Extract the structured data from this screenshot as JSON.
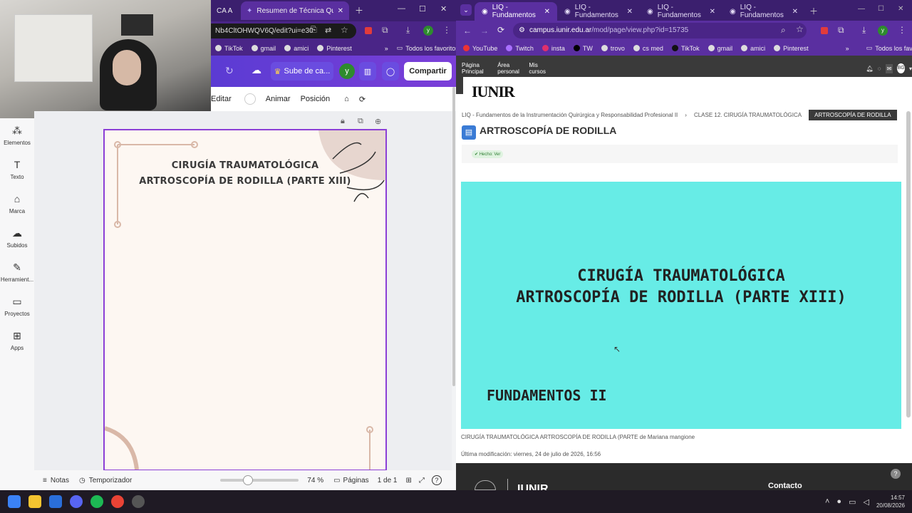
{
  "left": {
    "tabs": [
      {
        "label": "CA A"
      },
      {
        "label": "Resumen de Técnica Quirúrgic"
      }
    ],
    "url": "Nb4CltOHWQV6Q/edit?ui=e30",
    "bookmarks": [
      "TikTok",
      "gmail",
      "amici",
      "Pinterest"
    ],
    "bookmarks_folder": "Todos los favoritos",
    "upload_button": "Sube de ca...",
    "avatar_letter": "y",
    "share_button": "Compartir",
    "toolbar": {
      "edit": "Editar",
      "animate": "Animar",
      "position": "Posición"
    },
    "sidebar": [
      {
        "label": "Elementos",
        "icon": "elements-icon"
      },
      {
        "label": "Texto",
        "icon": "text-icon"
      },
      {
        "label": "Marca",
        "icon": "brand-icon"
      },
      {
        "label": "Subidos",
        "icon": "uploads-icon"
      },
      {
        "label": "Herramient...",
        "icon": "tools-icon"
      },
      {
        "label": "Proyectos",
        "icon": "projects-icon"
      },
      {
        "label": "Apps",
        "icon": "apps-icon"
      }
    ],
    "doc": {
      "line1": "CIRUGÍA TRAUMATOLÓGICA",
      "line2": "ARTROSCOPÍA DE RODILLA (PARTE XIII)"
    },
    "bottom": {
      "notes": "Notas",
      "timer": "Temporizador",
      "zoom": "74 %",
      "zoom_level": 0.35,
      "pages": "Páginas",
      "page_count": "1 de 1"
    }
  },
  "right": {
    "tabs": [
      {
        "label": "LIQ - Fundamentos"
      },
      {
        "label": "LIQ - Fundamentos"
      },
      {
        "label": "LIQ - Fundamentos"
      },
      {
        "label": "LIQ - Fundamentos"
      }
    ],
    "url_domain": "campus.iunir.edu.ar",
    "url_path": "/mod/page/view.php?id=15735",
    "bookmarks": [
      "YouTube",
      "Twitch",
      "insta",
      "TW",
      "trovo",
      "cs med",
      "TikTok",
      "gmail",
      "amici",
      "Pinterest"
    ],
    "bookmarks_folder": "Todos los favoritos",
    "avatar_letter": "y",
    "nav": [
      "Página Principal",
      "Área personal",
      "Mis cursos"
    ],
    "user_initials": "BG",
    "logo": "IUNIR",
    "breadcrumb": [
      "LIQ - Fundamentos de la Instrumentación Quirúrgica y Responsabilidad Profesional II",
      "CLASE 12. CIRUGÍA TRAUMATOLÓGICA",
      "ARTROSCOPÍA DE RODILLA"
    ],
    "page_title": "ARTROSCOPÍA DE RODILLA",
    "completion": "✔ Hecho: Ver",
    "banner": {
      "line1": "CIRUGÍA TRAUMATOLÓGICA",
      "line2": "ARTROSCOPÍA DE RODILLA (PARTE XIII)",
      "line3": "FUNDAMENTOS II",
      "bg": "#67ece6"
    },
    "caption_title": "CIRUGÍA TRAUMATOLÓGICA ARTROSCOPÍA DE RODILLA (PARTE",
    "caption_author": "de Mariana mangione",
    "last_modified": "Última modificación: viernes, 24 de julio de 2026, 16:56",
    "footer_logo": "IUNIR",
    "footer_contact": "Contacto"
  },
  "taskbar": {
    "time": "14:57",
    "date": "20/08/2026"
  }
}
